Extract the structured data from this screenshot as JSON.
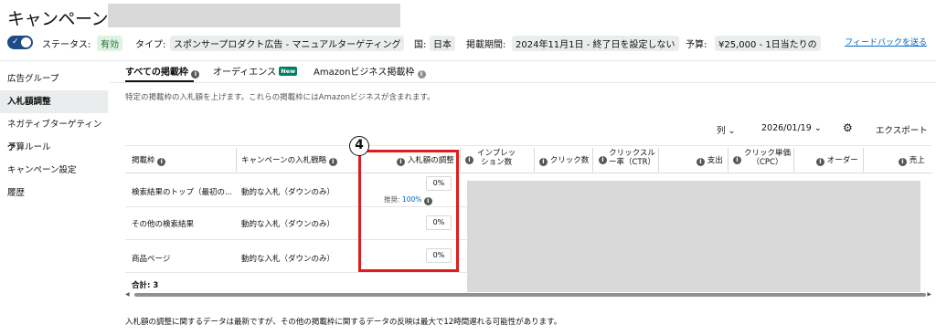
{
  "header": {
    "title": "キャンペーン:",
    "status_label": "ステータス:",
    "status_value": "有効",
    "type_label": "タイプ:",
    "type_value": "スポンサープロダクト広告 - マニュアルターゲティング",
    "country_label": "国:",
    "country_value": "日本",
    "period_label": "掲載期間:",
    "period_value": "2024年11月1日 - 終了日を設定しない",
    "budget_label": "予算:",
    "budget_value": "¥25,000 - 1日当たりの",
    "feedback_link": "フィードバックを送る"
  },
  "sidebar": {
    "items": [
      {
        "label": "広告グループ"
      },
      {
        "label": "入札額調整"
      },
      {
        "label": "ネガティブターゲティング"
      },
      {
        "label": "予算ルール"
      },
      {
        "label": "キャンペーン設定"
      },
      {
        "label": "履歴"
      }
    ]
  },
  "tabs": [
    {
      "label": "すべての掲載枠"
    },
    {
      "label": "オーディエンス",
      "badge": "New"
    },
    {
      "label": "Amazonビジネス掲載枠"
    }
  ],
  "description": "特定の掲載枠の入札額を上げます。これらの掲載枠にはAmazonビジネスが含まれます。",
  "toolbar": {
    "columns_label": "列",
    "date_label": "2026/01/19",
    "export_label": "エクスポート"
  },
  "table": {
    "headers": {
      "placement": "掲載枠",
      "strategy": "キャンペーンの入札戦略",
      "adjustment": "入札額の調整",
      "impressions": "インプレッ\nション数",
      "clicks": "クリック数",
      "ctr": "クリックスル\nー率（CTR）",
      "spend": "支出",
      "cpc": "クリック単価\n（CPC）",
      "orders": "オーダー",
      "sales": "売上"
    },
    "rows": [
      {
        "placement": "検索結果のトップ（最初の...",
        "strategy": "動的な入札（ダウンのみ）",
        "adjustment": "0%",
        "recommended_label": "推奨:",
        "recommended_value": "100%"
      },
      {
        "placement": "その他の検索結果",
        "strategy": "動的な入札（ダウンのみ）",
        "adjustment": "0%"
      },
      {
        "placement": "商品ページ",
        "strategy": "動的な入札（ダウンのみ）",
        "adjustment": "0%"
      }
    ],
    "total": "合計: 3"
  },
  "annotation_number": "4",
  "footnote": "入札額の調整に関するデータは最新ですが、その他の掲載枠に関するデータの反映は最大で12時間遅れる可能性があります。",
  "colors": {
    "toggle": "#1d4b86",
    "annotation_box": "#e11b1b",
    "link": "#0066c0",
    "new_badge": "#067d62"
  }
}
